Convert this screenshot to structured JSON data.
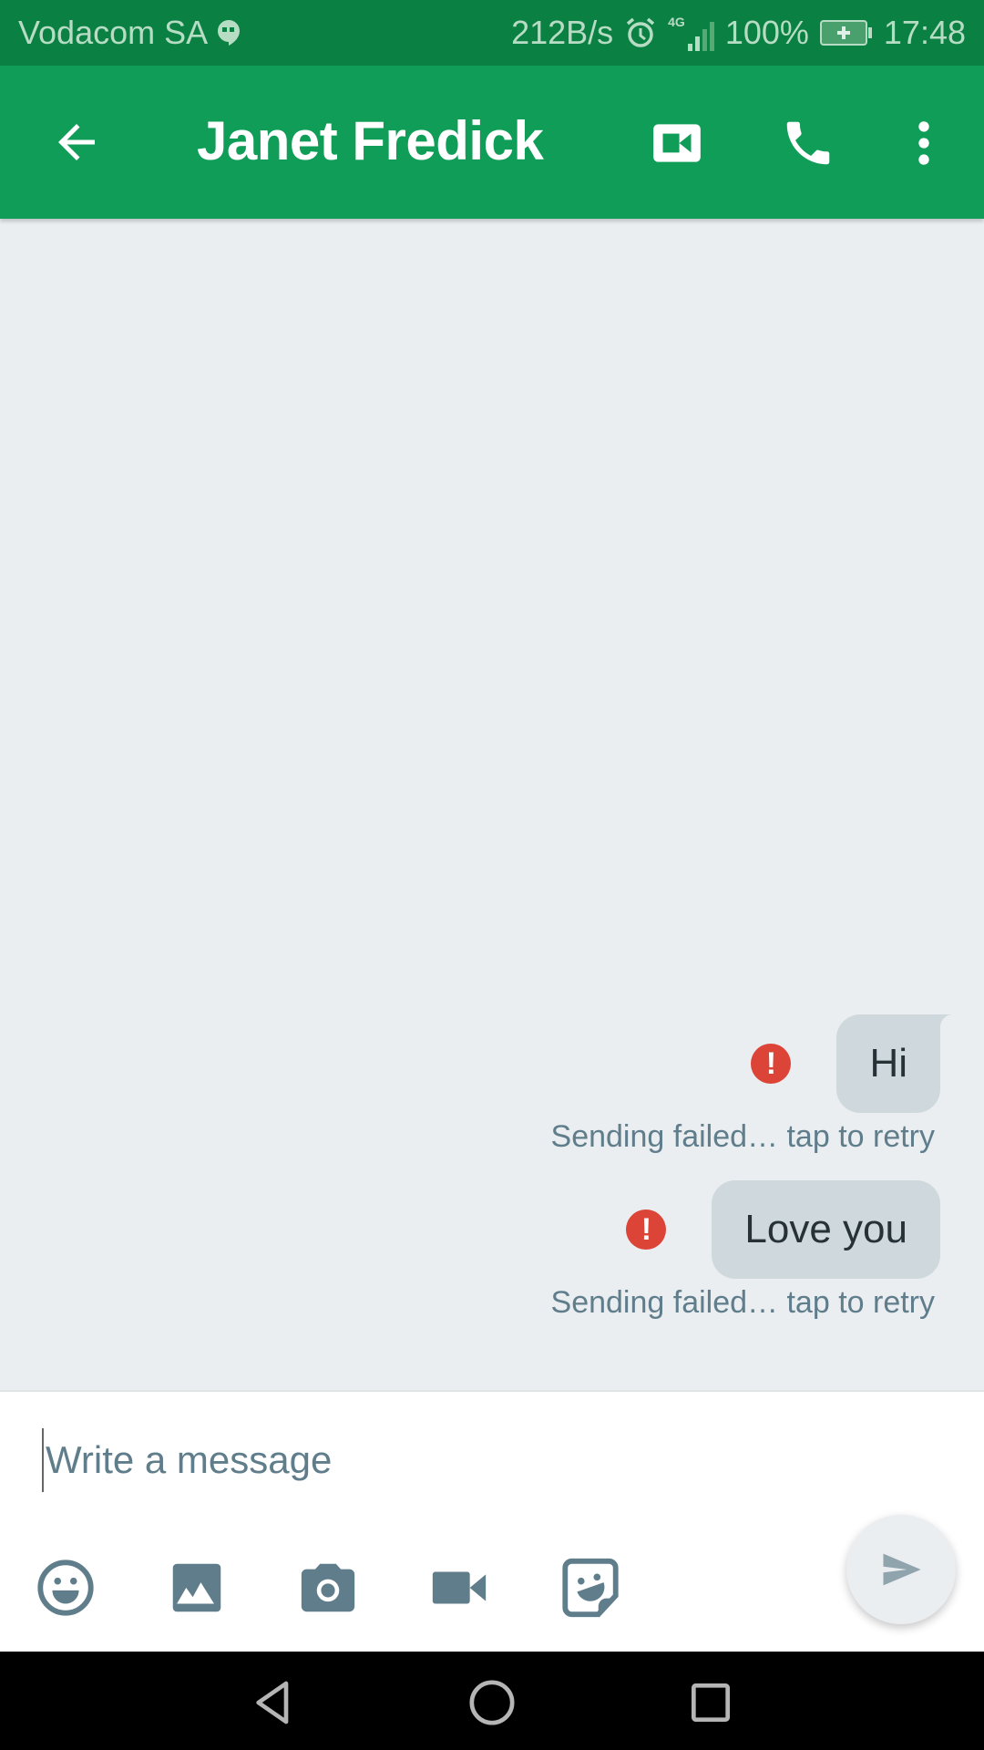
{
  "status_bar": {
    "carrier": "Vodacom SA",
    "net_speed": "212B/s",
    "network": "4G",
    "battery": "100%",
    "time": "17:48"
  },
  "app_bar": {
    "contact_name": "Janet Fredick",
    "icons": [
      "back-arrow-icon",
      "video-call-icon",
      "phone-call-icon",
      "more-vert-icon"
    ]
  },
  "messages": [
    {
      "text": "Hi",
      "status": "Sending failed… tap to retry"
    },
    {
      "text": "Love you",
      "status": "Sending failed… tap to retry"
    }
  ],
  "composer": {
    "placeholder": "Write a message",
    "value": "",
    "tools": [
      "emoji-icon",
      "image-icon",
      "camera-icon",
      "video-icon",
      "sticker-icon"
    ],
    "send_icon": "send-icon"
  },
  "colors": {
    "status_bar": "#0b8043",
    "app_bar": "#0f9d58",
    "chat_bg": "#eaeef1",
    "bubble": "#cfd8dd",
    "error": "#db4437",
    "icon": "#607d8b"
  }
}
